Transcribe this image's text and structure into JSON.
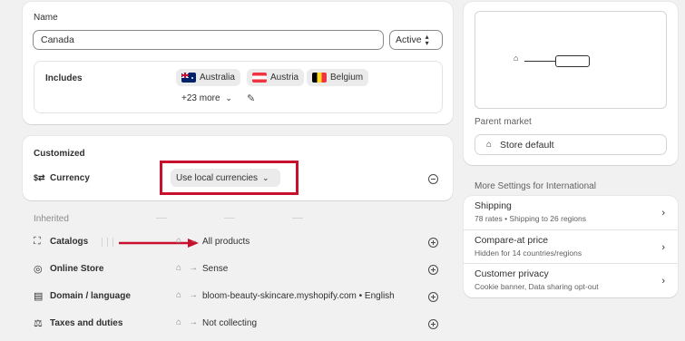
{
  "name_section": {
    "label": "Name",
    "value": "Canada",
    "status": "Active",
    "includes_label": "Includes",
    "countries": [
      "Australia",
      "Austria",
      "Belgium"
    ],
    "more": "+23 more"
  },
  "customized": {
    "title": "Customized",
    "currency_label": "Currency",
    "currency_value": "Use local currencies"
  },
  "inherited": {
    "title": "Inherited",
    "rows": [
      {
        "label": "Catalogs",
        "value": "All products"
      },
      {
        "label": "Online Store",
        "value": "Sense"
      },
      {
        "label": "Domain / language",
        "value": "bloom-beauty-skincare.myshopify.com • English"
      },
      {
        "label": "Taxes and duties",
        "value": "Not collecting"
      }
    ]
  },
  "parent": {
    "label": "Parent market",
    "value": "Store default"
  },
  "more_settings": {
    "title": "More Settings for International",
    "items": [
      {
        "title": "Shipping",
        "subtitle": "78 rates • Shipping to 26 regions"
      },
      {
        "title": "Compare-at price",
        "subtitle": "Hidden for 14 countries/regions"
      },
      {
        "title": "Customer privacy",
        "subtitle": "Cookie banner, Data sharing opt-out"
      }
    ]
  },
  "colors": {
    "highlight": "#c8102e",
    "arrow": "#c8102e"
  }
}
